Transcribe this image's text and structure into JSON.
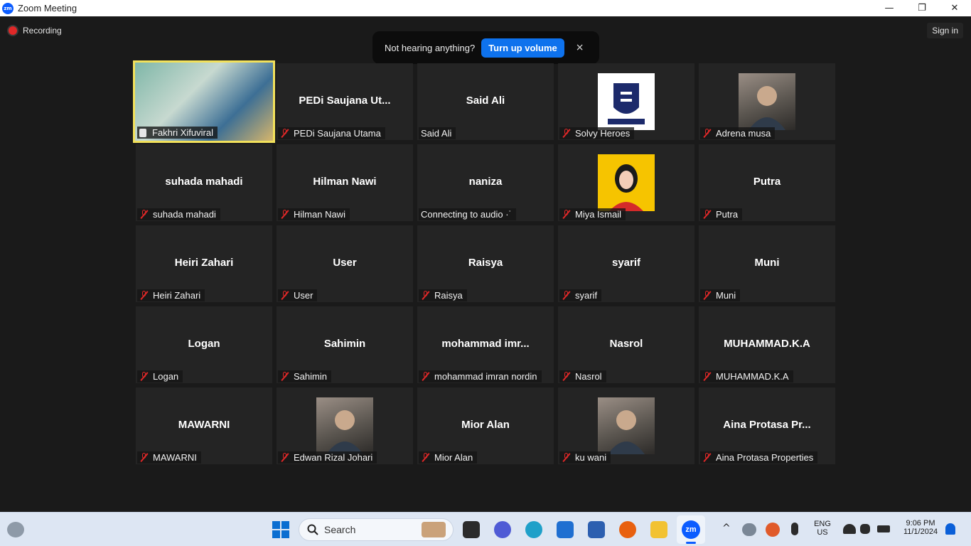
{
  "window": {
    "title": "Zoom Meeting",
    "app_icon_text": "zm"
  },
  "window_controls": {
    "minimize": "—",
    "maximize": "❐",
    "close": "✕"
  },
  "recording": {
    "label": "Recording"
  },
  "signin": {
    "label": "Sign in"
  },
  "audio_notice": {
    "message": "Not hearing anything?",
    "button": "Turn up volume",
    "close": "×"
  },
  "participants": [
    {
      "center": "",
      "label": "Fakhri Xifuviral",
      "muted": false,
      "video": true
    },
    {
      "center": "PEDi  Saujana  Ut...",
      "label": "PEDi Saujana Utama",
      "muted": true
    },
    {
      "center": "Said Ali",
      "label": "Said Ali",
      "muted": false
    },
    {
      "center": "",
      "label": "Solvy Heroes",
      "muted": true,
      "avatar": "solvy-logo"
    },
    {
      "center": "",
      "label": "Adrena musa",
      "muted": true,
      "avatar": "photo"
    },
    {
      "center": "suhada mahadi",
      "label": "suhada mahadi",
      "muted": true
    },
    {
      "center": "Hilman Nawi",
      "label": "Hilman Nawi",
      "muted": true
    },
    {
      "center": "naniza",
      "label": "Connecting to audio ·˙",
      "muted": false
    },
    {
      "center": "",
      "label": "Miya Ismail",
      "muted": true,
      "avatar": "illustration"
    },
    {
      "center": "Putra",
      "label": "Putra",
      "muted": true
    },
    {
      "center": "Heiri Zahari",
      "label": "Heiri Zahari",
      "muted": true
    },
    {
      "center": "User",
      "label": "User",
      "muted": true
    },
    {
      "center": "Raisya",
      "label": "Raisya",
      "muted": true
    },
    {
      "center": "syarif",
      "label": "syarif",
      "muted": true
    },
    {
      "center": "Muni",
      "label": "Muni",
      "muted": true
    },
    {
      "center": "Logan",
      "label": "Logan",
      "muted": true
    },
    {
      "center": "Sahimin",
      "label": "Sahimin",
      "muted": true
    },
    {
      "center": "mohammad  imr...",
      "label": "mohammad imran nordin",
      "muted": true
    },
    {
      "center": "Nasrol",
      "label": "Nasrol",
      "muted": true
    },
    {
      "center": "MUHAMMAD.K.A",
      "label": "MUHAMMAD.K.A",
      "muted": true
    },
    {
      "center": "MAWARNI",
      "label": "MAWARNI",
      "muted": true
    },
    {
      "center": "",
      "label": "Edwan Rizal Johari",
      "muted": true,
      "avatar": "photo"
    },
    {
      "center": "Mior Alan",
      "label": "Mior Alan",
      "muted": true
    },
    {
      "center": "",
      "label": "ku wani",
      "muted": true,
      "avatar": "photo"
    },
    {
      "center": "Aina Protasa Pr...",
      "label": "Aina Protasa Properties",
      "muted": true
    }
  ],
  "taskbar": {
    "search_placeholder": "Search",
    "language": "ENG",
    "region": "US",
    "time": "9:06 PM",
    "date": "11/1/2024"
  },
  "colors": {
    "accent": "#0e72ed",
    "muted_icon": "#e02828",
    "active_border": "#f2e15b"
  }
}
